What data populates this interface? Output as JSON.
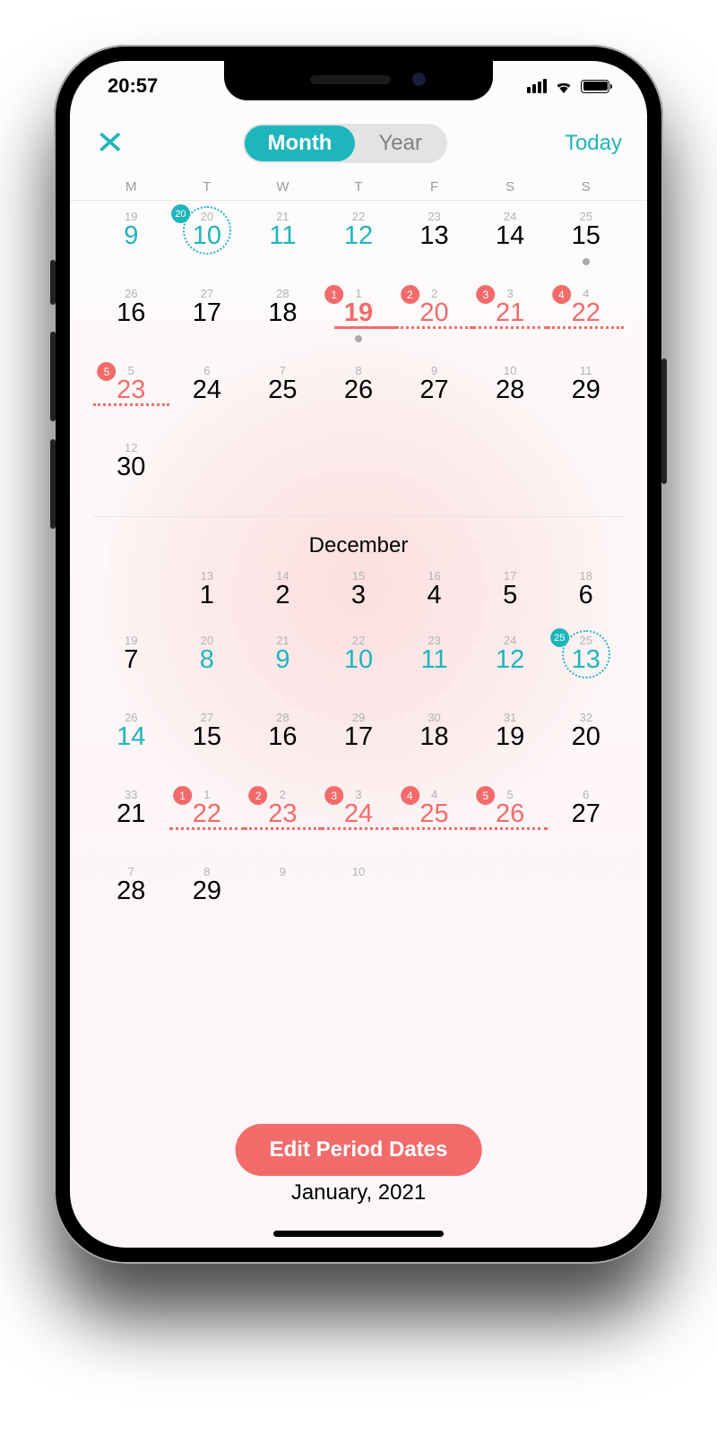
{
  "status": {
    "time": "20:57"
  },
  "nav": {
    "close_glyph": "✕",
    "month_label": "Month",
    "year_label": "Year",
    "today_label": "Today"
  },
  "weekdays": [
    "M",
    "T",
    "W",
    "T",
    "F",
    "S",
    "S"
  ],
  "months": {
    "nov": {
      "week1": [
        {
          "cycle": "19",
          "day": "9",
          "teal": true
        },
        {
          "cycle": "20",
          "day": "10",
          "teal": true,
          "ov": true,
          "ovBadge": "20"
        },
        {
          "cycle": "21",
          "day": "11",
          "teal": true
        },
        {
          "cycle": "22",
          "day": "12",
          "teal": true
        },
        {
          "cycle": "23",
          "day": "13"
        },
        {
          "cycle": "24",
          "day": "14"
        },
        {
          "cycle": "25",
          "day": "15",
          "dot": true
        }
      ],
      "week2": [
        {
          "cycle": "26",
          "day": "16"
        },
        {
          "cycle": "27",
          "day": "17"
        },
        {
          "cycle": "28",
          "day": "18"
        },
        {
          "cycle": "1",
          "day": "19",
          "coral": true,
          "today": true,
          "badge": "1",
          "solidUnder": true,
          "dot": true
        },
        {
          "cycle": "2",
          "day": "20",
          "coral": true,
          "badge": "2",
          "dottedUnder": true
        },
        {
          "cycle": "3",
          "day": "21",
          "coral": true,
          "badge": "3",
          "dottedUnder": true
        },
        {
          "cycle": "4",
          "day": "22",
          "coral": true,
          "badge": "4",
          "dottedUnder": true
        }
      ],
      "week3": [
        {
          "cycle": "5",
          "day": "23",
          "coral": true,
          "badge": "5",
          "dottedUnder": true
        },
        {
          "cycle": "6",
          "day": "24"
        },
        {
          "cycle": "7",
          "day": "25"
        },
        {
          "cycle": "8",
          "day": "26"
        },
        {
          "cycle": "9",
          "day": "27"
        },
        {
          "cycle": "10",
          "day": "28"
        },
        {
          "cycle": "11",
          "day": "29"
        }
      ],
      "week4": [
        {
          "cycle": "12",
          "day": "30"
        },
        {},
        {},
        {},
        {},
        {},
        {}
      ]
    },
    "dec": {
      "label": "December",
      "week1": [
        {},
        {
          "cycle": "13",
          "day": "1"
        },
        {
          "cycle": "14",
          "day": "2"
        },
        {
          "cycle": "15",
          "day": "3"
        },
        {
          "cycle": "16",
          "day": "4"
        },
        {
          "cycle": "17",
          "day": "5"
        },
        {
          "cycle": "18",
          "day": "6"
        }
      ],
      "week2": [
        {
          "cycle": "19",
          "day": "7"
        },
        {
          "cycle": "20",
          "day": "8",
          "teal": true
        },
        {
          "cycle": "21",
          "day": "9",
          "teal": true
        },
        {
          "cycle": "22",
          "day": "10",
          "teal": true
        },
        {
          "cycle": "23",
          "day": "11",
          "teal": true
        },
        {
          "cycle": "24",
          "day": "12",
          "teal": true
        },
        {
          "cycle": "25",
          "day": "13",
          "teal": true,
          "ov": true,
          "ovBadge": "25"
        }
      ],
      "week3": [
        {
          "cycle": "26",
          "day": "14",
          "teal": true
        },
        {
          "cycle": "27",
          "day": "15"
        },
        {
          "cycle": "28",
          "day": "16"
        },
        {
          "cycle": "29",
          "day": "17"
        },
        {
          "cycle": "30",
          "day": "18"
        },
        {
          "cycle": "31",
          "day": "19"
        },
        {
          "cycle": "32",
          "day": "20"
        }
      ],
      "week4": [
        {
          "cycle": "33",
          "day": "21"
        },
        {
          "cycle": "1",
          "day": "22",
          "coral": true,
          "badge": "1",
          "dottedUnder": true
        },
        {
          "cycle": "2",
          "day": "23",
          "coral": true,
          "badge": "2",
          "dottedUnder": true
        },
        {
          "cycle": "3",
          "day": "24",
          "coral": true,
          "badge": "3",
          "dottedUnder": true
        },
        {
          "cycle": "4",
          "day": "25",
          "coral": true,
          "badge": "4",
          "dottedUnder": true
        },
        {
          "cycle": "5",
          "day": "26",
          "coral": true,
          "badge": "5",
          "dottedUnder": true
        },
        {
          "cycle": "6",
          "day": "27"
        }
      ],
      "week5": [
        {
          "cycle": "7",
          "day": "28"
        },
        {
          "cycle": "8",
          "day": "29"
        },
        {
          "cycle": "9",
          "day": ""
        },
        {
          "cycle": "10",
          "day": ""
        },
        {},
        {},
        {}
      ]
    }
  },
  "edit_button": "Edit Period Dates",
  "next_month_label": "January, 2021",
  "colors": {
    "teal": "#1fb5bc",
    "coral": "#f26b6b"
  }
}
